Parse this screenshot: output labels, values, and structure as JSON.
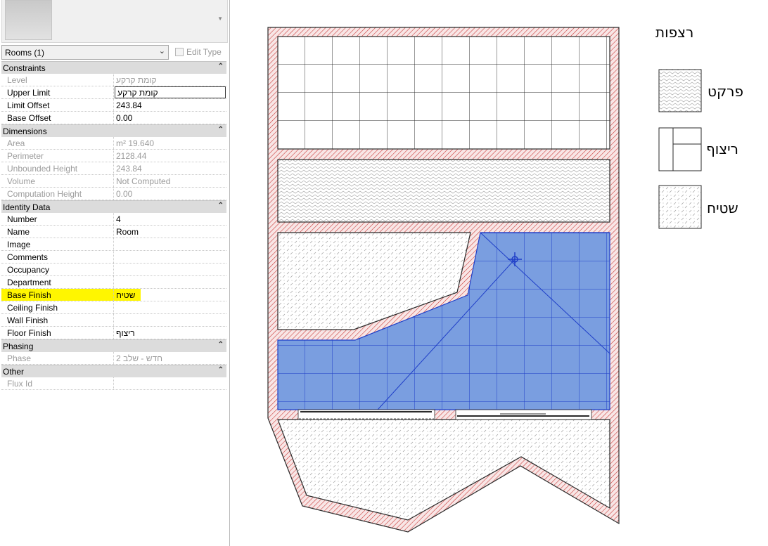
{
  "properties": {
    "type_selector": "Rooms (1)",
    "edit_type_label": "Edit Type",
    "sections": [
      {
        "title": "Constraints",
        "rows": [
          {
            "key": "Level",
            "value": "קומת קרקע",
            "readonly": true
          },
          {
            "key": "Upper Limit",
            "value": "קומת קרקע",
            "editing": true
          },
          {
            "key": "Limit Offset",
            "value": "243.84"
          },
          {
            "key": "Base Offset",
            "value": "0.00"
          }
        ]
      },
      {
        "title": "Dimensions",
        "rows": [
          {
            "key": "Area",
            "value": "19.640 m²",
            "readonly": true
          },
          {
            "key": "Perimeter",
            "value": "2128.44",
            "readonly": true
          },
          {
            "key": "Unbounded Height",
            "value": "243.84",
            "readonly": true
          },
          {
            "key": "Volume",
            "value": "Not Computed",
            "readonly": true
          },
          {
            "key": "Computation Height",
            "value": "0.00",
            "readonly": true
          }
        ]
      },
      {
        "title": "Identity Data",
        "rows": [
          {
            "key": "Number",
            "value": "4"
          },
          {
            "key": "Name",
            "value": "Room"
          },
          {
            "key": "Image",
            "value": ""
          },
          {
            "key": "Comments",
            "value": ""
          },
          {
            "key": "Occupancy",
            "value": ""
          },
          {
            "key": "Department",
            "value": ""
          },
          {
            "key": "Base Finish",
            "value": "שטיח",
            "highlight": true
          },
          {
            "key": "Ceiling Finish",
            "value": ""
          },
          {
            "key": "Wall Finish",
            "value": ""
          },
          {
            "key": "Floor Finish",
            "value": "ריצוף"
          }
        ]
      },
      {
        "title": "Phasing",
        "rows": [
          {
            "key": "Phase",
            "value": "חדש - שלב 2",
            "readonly": true
          }
        ]
      },
      {
        "title": "Other",
        "rows": [
          {
            "key": "Flux Id",
            "value": "",
            "readonly": true
          }
        ]
      }
    ]
  },
  "legend": {
    "title": "רצפות",
    "items": [
      {
        "label": "פרקט",
        "pattern": "parquet"
      },
      {
        "label": "ריצוף",
        "pattern": "tiles"
      },
      {
        "label": "שטיח",
        "pattern": "carpet"
      }
    ]
  },
  "colors": {
    "wall_hatch": "#c9322f",
    "wall_fill": "#f8e6e6",
    "selection_fill": "#7a9ee0",
    "selection_line": "#1f3fc8",
    "panel_header": "#dcdcdc",
    "highlight": "#fff600"
  },
  "icons": {
    "collapse": "double-chevron-up-icon",
    "dropdown": "chevron-down-icon",
    "move_cursor": "move-crosshair-icon",
    "type_thumbnail": "revit-logo-icon"
  }
}
